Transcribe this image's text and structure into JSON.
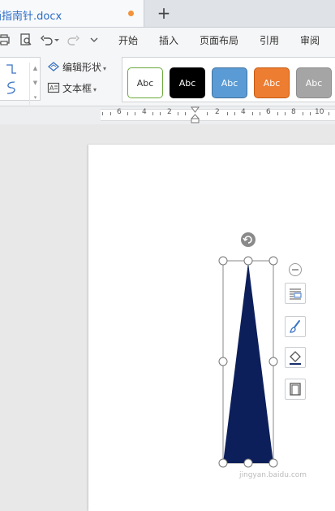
{
  "tab": {
    "title": "画指南针.docx"
  },
  "menu": {
    "items": [
      "开始",
      "插入",
      "页面布局",
      "引用",
      "审阅"
    ]
  },
  "ribbon": {
    "edit_shape_label": "编辑形状",
    "textbox_label": "文本框",
    "style_swatches": [
      {
        "text": "Abc",
        "bg": "#ffffff",
        "border": "#6aaa3a",
        "fg": "#333333"
      },
      {
        "text": "Abc",
        "bg": "#000000",
        "border": "#000000",
        "fg": "#ffffff"
      },
      {
        "text": "Abc",
        "bg": "#5b9bd5",
        "border": "#41719c",
        "fg": "#ffffff"
      },
      {
        "text": "Abc",
        "bg": "#ed7d31",
        "border": "#c55a11",
        "fg": "#ffffff"
      },
      {
        "text": "Abc",
        "bg": "#a5a5a5",
        "border": "#8c8c8c",
        "fg": "#ffffff"
      }
    ]
  },
  "ruler": {
    "labels": [
      "6",
      "4",
      "2",
      "2",
      "4",
      "6",
      "8",
      "10"
    ]
  },
  "shape": {
    "fill": "#0c1f5b"
  },
  "watermark": "jingyan.baidu.com"
}
